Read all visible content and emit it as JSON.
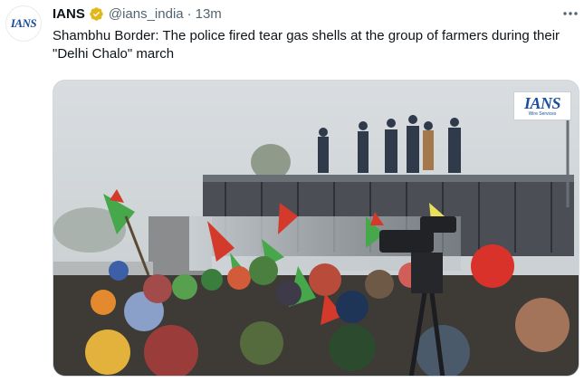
{
  "tweet": {
    "avatar_text": "IANS",
    "display_name": "IANS",
    "verified_icon": "verified-badge-icon",
    "handle": "@ians_india",
    "separator": "·",
    "time": "13m",
    "more_icon": "more-horizontal-icon",
    "text": "Shambhu Border: The police fired tear gas shells at the group of farmers during their \"Delhi Chalo\" march"
  },
  "media": {
    "watermark_logo": "IANS",
    "watermark_sub": "Wire Services"
  },
  "colors": {
    "verified_gold": "#e2b719",
    "text_primary": "#0f1419",
    "text_secondary": "#536471",
    "ians_blue": "#1b4f9e"
  }
}
